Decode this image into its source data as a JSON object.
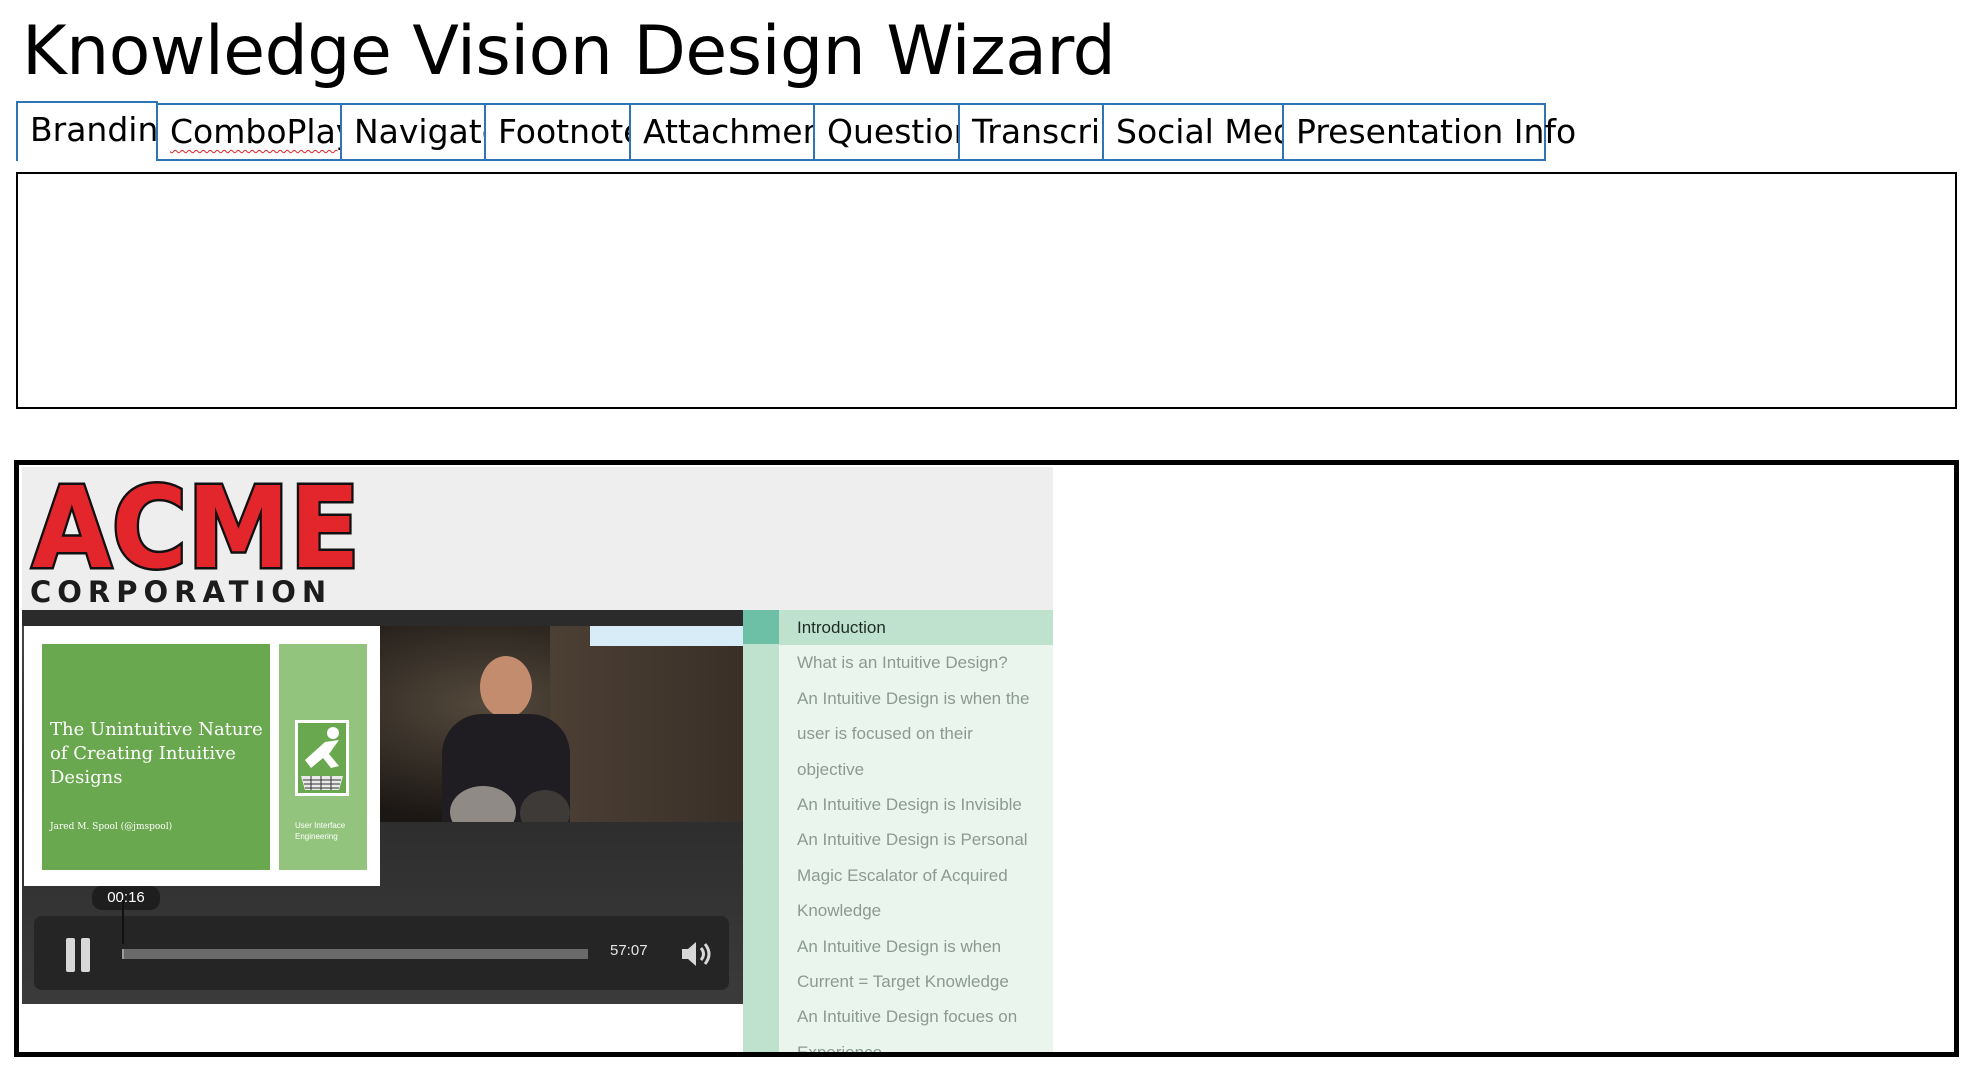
{
  "window": {
    "title": "Knowledge Vision Design Wizard"
  },
  "tabs": [
    {
      "label": "Branding"
    },
    {
      "label": "ComboPlayer"
    },
    {
      "label": "Navigator"
    },
    {
      "label": "Footnotes"
    },
    {
      "label": "Attachments"
    },
    {
      "label": "Question"
    },
    {
      "label": "Transcript"
    },
    {
      "label": "Social Media"
    },
    {
      "label": "Presentation Info"
    }
  ],
  "active_tab": "Branding",
  "colors": {
    "tab_border": "#2e75b6",
    "logo_red": "#e3262c",
    "nav_accent": "#6dc0a6",
    "nav_active": "#bfe2cf"
  },
  "preview": {
    "logo": {
      "word": "ACME",
      "subtitle": "CORPORATION"
    },
    "slide": {
      "title": "The Unintuitive Nature of Creating Intuitive Designs",
      "author": "Jared M. Spool (@jmspool)",
      "side_text": "User Interface Engineering"
    },
    "player": {
      "current_time": "00:16",
      "duration": "57:07",
      "progress_percent": 0.5,
      "state": "playing",
      "icons": {
        "pause": "pause-icon",
        "volume": "volume-icon"
      }
    },
    "navigator": {
      "items": [
        {
          "label": "Introduction"
        },
        {
          "label": "What is an Intuitive Design?"
        },
        {
          "label": "An Intuitive Design is when the"
        },
        {
          "label": "user is focused on their"
        },
        {
          "label": "objective"
        },
        {
          "label": "An Intuitive Design is Invisible"
        },
        {
          "label": "An Intuitive Design is Personal"
        },
        {
          "label": "Magic Escalator of Acquired"
        },
        {
          "label": "Knowledge"
        },
        {
          "label": "An Intuitive Design is when"
        },
        {
          "label": "Current = Target Knowledge"
        },
        {
          "label": "An Intuitive Design focues on"
        },
        {
          "label": "Experience"
        }
      ]
    }
  }
}
